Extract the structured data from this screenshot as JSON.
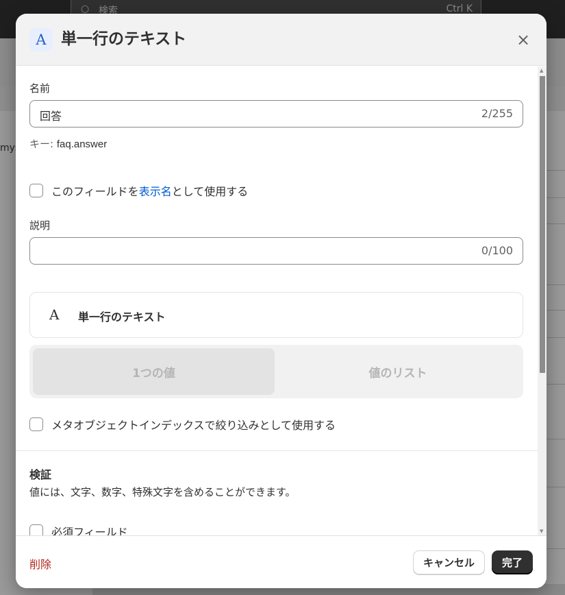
{
  "background": {
    "search_placeholder": "検索",
    "search_shortcut": "Ctrl K",
    "side_text": "mys"
  },
  "modal": {
    "type_icon": "A",
    "title": "単一行のテキスト",
    "close_icon": "×",
    "name_field": {
      "label": "名前",
      "value": "回答",
      "counter": "2/255"
    },
    "key_helper": {
      "prefix": "キー:",
      "value": "faq.answer"
    },
    "display_name_checkbox": {
      "before": "このフィールドを",
      "link": "表示名",
      "after": "として使用する",
      "checked": false
    },
    "description_field": {
      "label": "説明",
      "value": "",
      "counter": "0/100"
    },
    "type_card": {
      "icon": "A",
      "name": "単一行のテキスト"
    },
    "value_mode": {
      "single": "1つの値",
      "list": "値のリスト",
      "selected": "single"
    },
    "filter_checkbox": {
      "label": "メタオブジェクトインデックスで絞り込みとして使用する",
      "checked": false
    },
    "validation": {
      "title": "検証",
      "description": "値には、文字、数字、特殊文字を含めることができます。",
      "required_label": "必須フィールド",
      "required_checked": false
    },
    "footer": {
      "delete": "削除",
      "cancel": "キャンセル",
      "done": "完了"
    }
  }
}
